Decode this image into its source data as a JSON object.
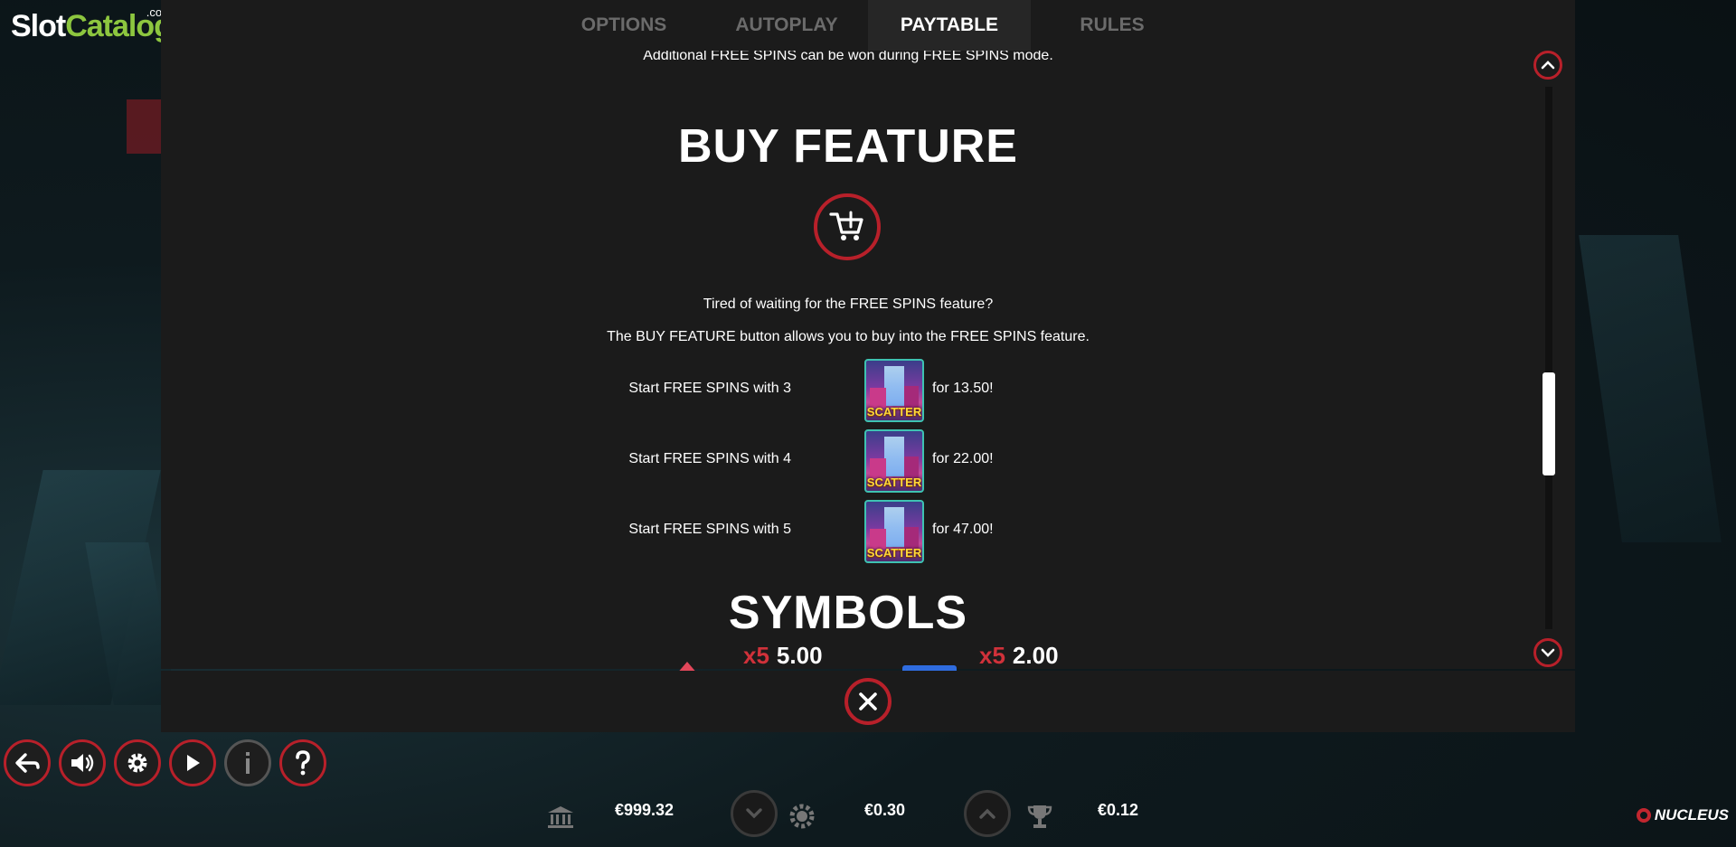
{
  "logo": {
    "primary": "Slot",
    "secondary": "Catalog",
    "suffix": ".com"
  },
  "tabs": [
    {
      "label": "OPTIONS",
      "active": false
    },
    {
      "label": "AUTOPLAY",
      "active": false
    },
    {
      "label": "PAYTABLE",
      "active": true
    },
    {
      "label": "RULES",
      "active": false
    }
  ],
  "paytable": {
    "free_spins_note": "Additional FREE SPINS can be won during FREE SPINS mode.",
    "buy_feature": {
      "title": "BUY FEATURE",
      "icon": "cart-plus-icon",
      "line1": "Tired of waiting for the FREE SPINS feature?",
      "line2": "The BUY FEATURE button allows you to buy into the FREE SPINS feature.",
      "options": [
        {
          "label": "Start FREE SPINS with 3",
          "symbol": "SCATTER",
          "price": "for 13.50!"
        },
        {
          "label": "Start FREE SPINS with 4",
          "symbol": "SCATTER",
          "price": "for 22.00!"
        },
        {
          "label": "Start FREE SPINS with 5",
          "symbol": "SCATTER",
          "price": "for 47.00!"
        }
      ]
    },
    "symbols": {
      "title": "SYMBOLS",
      "items": [
        {
          "multiplier": "x5",
          "value": "5.00"
        },
        {
          "multiplier": "x5",
          "value": "2.00"
        }
      ]
    }
  },
  "footer": {
    "balance": "€999.32",
    "bet": "€0.30",
    "win": "€0.12",
    "brand": "NUCLEUS"
  },
  "colors": {
    "accent": "#b8202a",
    "panel": "#1b1b1b",
    "logo_green": "#8dc63f"
  }
}
